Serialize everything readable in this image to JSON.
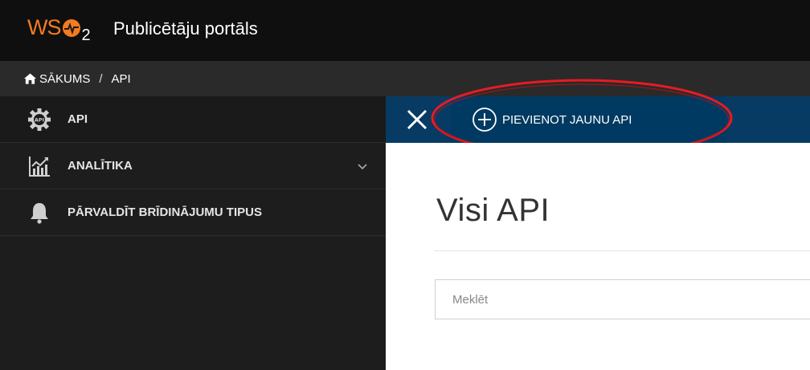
{
  "header": {
    "logo_text": "WS",
    "logo_subscript": "2",
    "title": "Publicētāju portāls"
  },
  "breadcrumb": {
    "home_label": "SĀKUMS",
    "separator": "/",
    "current": "API"
  },
  "sidebar": {
    "items": [
      {
        "label": "API",
        "icon": "api-gear-icon"
      },
      {
        "label": "ANALĪTIKA",
        "icon": "analytics-chart-icon",
        "expandable": true
      },
      {
        "label": "PĀRVALDĪT BRĪDINĀJUMU TIPUS",
        "icon": "bell-icon"
      }
    ]
  },
  "toolbar": {
    "add_label": "PIEVIENOT JAUNU API"
  },
  "main": {
    "title": "Visi API",
    "search_placeholder": "Meklēt"
  },
  "colors": {
    "brand_orange": "#f47b20",
    "topbar": "#0f0f0f",
    "breadcrumb_bar": "#2a2a2a",
    "sidebar": "#1d1d1d",
    "action_bar": "#073b63",
    "annotation": "#d9141b"
  }
}
